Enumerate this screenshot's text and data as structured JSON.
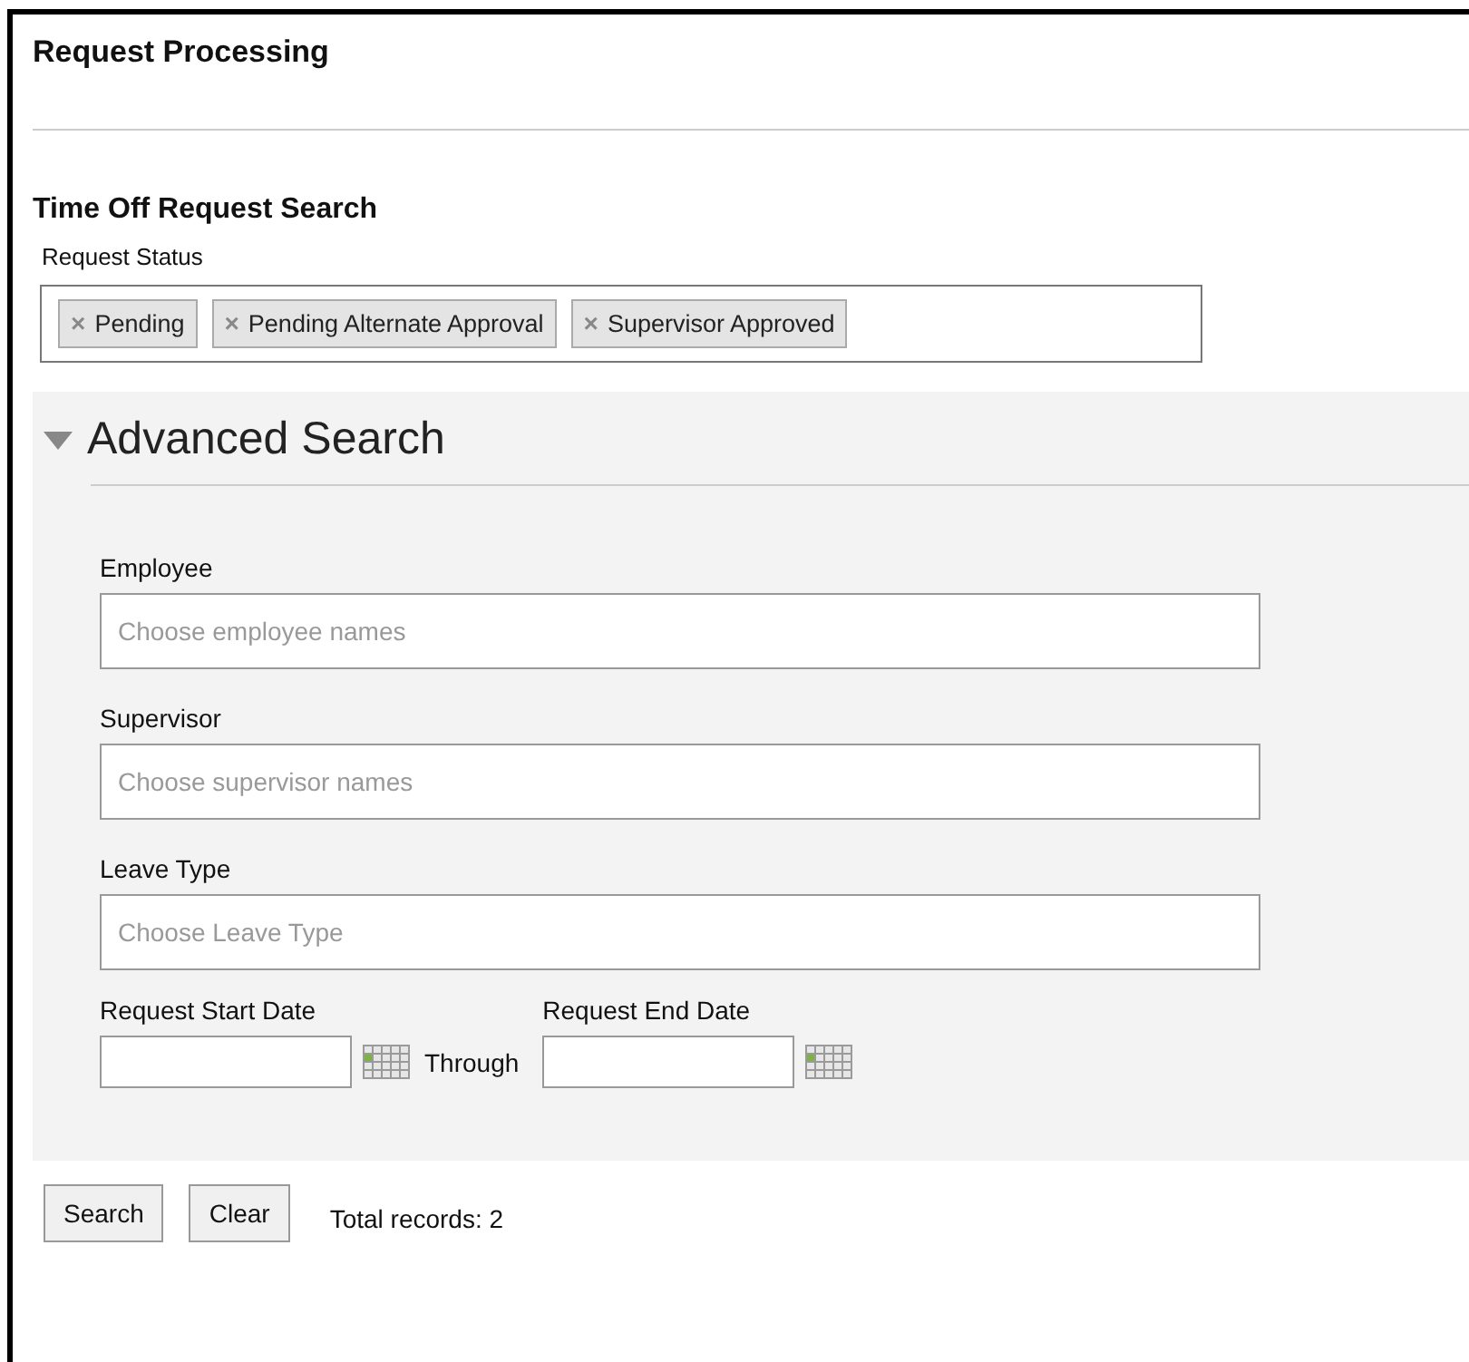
{
  "page_title": "Request Processing",
  "section_title": "Time Off Request Search",
  "request_status": {
    "label": "Request Status",
    "tags": [
      {
        "label": "Pending",
        "remove": "×"
      },
      {
        "label": "Pending Alternate Approval",
        "remove": "×"
      },
      {
        "label": "Supervisor Approved",
        "remove": "×"
      }
    ]
  },
  "advanced_search": {
    "title": "Advanced Search",
    "expanded": true,
    "fields": [
      {
        "label": "Employee",
        "placeholder": "Choose employee names"
      },
      {
        "label": "Supervisor",
        "placeholder": "Choose supervisor names"
      },
      {
        "label": "Leave Type",
        "placeholder": "Choose Leave Type"
      }
    ],
    "start_date": {
      "label": "Request Start Date"
    },
    "through": "Through",
    "end_date": {
      "label": "Request End Date"
    }
  },
  "buttons": [
    "Search",
    "Clear"
  ],
  "total_records": "Total records: 2"
}
